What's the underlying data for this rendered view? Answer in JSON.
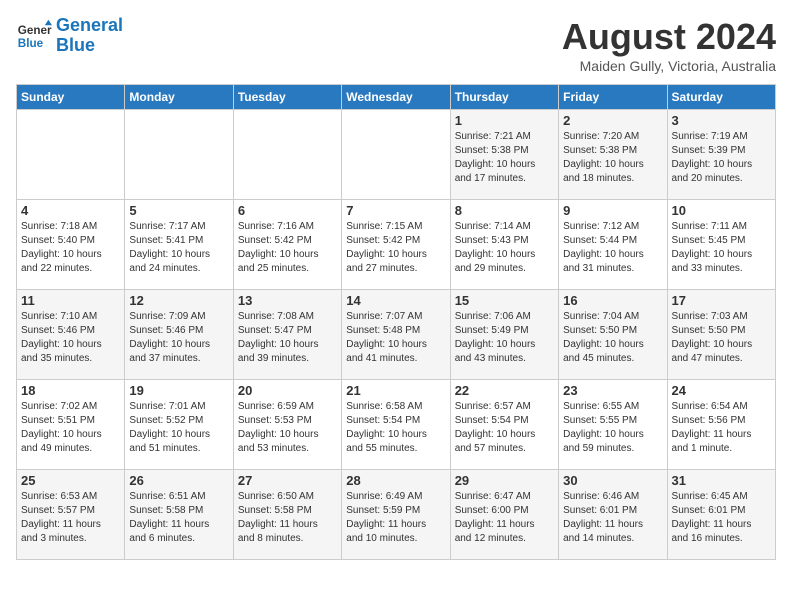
{
  "header": {
    "logo_text_general": "General",
    "logo_text_blue": "Blue",
    "month_title": "August 2024",
    "location": "Maiden Gully, Victoria, Australia"
  },
  "days_of_week": [
    "Sunday",
    "Monday",
    "Tuesday",
    "Wednesday",
    "Thursday",
    "Friday",
    "Saturday"
  ],
  "weeks": [
    [
      {
        "day": "",
        "info": ""
      },
      {
        "day": "",
        "info": ""
      },
      {
        "day": "",
        "info": ""
      },
      {
        "day": "",
        "info": ""
      },
      {
        "day": "1",
        "info": "Sunrise: 7:21 AM\nSunset: 5:38 PM\nDaylight: 10 hours\nand 17 minutes."
      },
      {
        "day": "2",
        "info": "Sunrise: 7:20 AM\nSunset: 5:38 PM\nDaylight: 10 hours\nand 18 minutes."
      },
      {
        "day": "3",
        "info": "Sunrise: 7:19 AM\nSunset: 5:39 PM\nDaylight: 10 hours\nand 20 minutes."
      }
    ],
    [
      {
        "day": "4",
        "info": "Sunrise: 7:18 AM\nSunset: 5:40 PM\nDaylight: 10 hours\nand 22 minutes."
      },
      {
        "day": "5",
        "info": "Sunrise: 7:17 AM\nSunset: 5:41 PM\nDaylight: 10 hours\nand 24 minutes."
      },
      {
        "day": "6",
        "info": "Sunrise: 7:16 AM\nSunset: 5:42 PM\nDaylight: 10 hours\nand 25 minutes."
      },
      {
        "day": "7",
        "info": "Sunrise: 7:15 AM\nSunset: 5:42 PM\nDaylight: 10 hours\nand 27 minutes."
      },
      {
        "day": "8",
        "info": "Sunrise: 7:14 AM\nSunset: 5:43 PM\nDaylight: 10 hours\nand 29 minutes."
      },
      {
        "day": "9",
        "info": "Sunrise: 7:12 AM\nSunset: 5:44 PM\nDaylight: 10 hours\nand 31 minutes."
      },
      {
        "day": "10",
        "info": "Sunrise: 7:11 AM\nSunset: 5:45 PM\nDaylight: 10 hours\nand 33 minutes."
      }
    ],
    [
      {
        "day": "11",
        "info": "Sunrise: 7:10 AM\nSunset: 5:46 PM\nDaylight: 10 hours\nand 35 minutes."
      },
      {
        "day": "12",
        "info": "Sunrise: 7:09 AM\nSunset: 5:46 PM\nDaylight: 10 hours\nand 37 minutes."
      },
      {
        "day": "13",
        "info": "Sunrise: 7:08 AM\nSunset: 5:47 PM\nDaylight: 10 hours\nand 39 minutes."
      },
      {
        "day": "14",
        "info": "Sunrise: 7:07 AM\nSunset: 5:48 PM\nDaylight: 10 hours\nand 41 minutes."
      },
      {
        "day": "15",
        "info": "Sunrise: 7:06 AM\nSunset: 5:49 PM\nDaylight: 10 hours\nand 43 minutes."
      },
      {
        "day": "16",
        "info": "Sunrise: 7:04 AM\nSunset: 5:50 PM\nDaylight: 10 hours\nand 45 minutes."
      },
      {
        "day": "17",
        "info": "Sunrise: 7:03 AM\nSunset: 5:50 PM\nDaylight: 10 hours\nand 47 minutes."
      }
    ],
    [
      {
        "day": "18",
        "info": "Sunrise: 7:02 AM\nSunset: 5:51 PM\nDaylight: 10 hours\nand 49 minutes."
      },
      {
        "day": "19",
        "info": "Sunrise: 7:01 AM\nSunset: 5:52 PM\nDaylight: 10 hours\nand 51 minutes."
      },
      {
        "day": "20",
        "info": "Sunrise: 6:59 AM\nSunset: 5:53 PM\nDaylight: 10 hours\nand 53 minutes."
      },
      {
        "day": "21",
        "info": "Sunrise: 6:58 AM\nSunset: 5:54 PM\nDaylight: 10 hours\nand 55 minutes."
      },
      {
        "day": "22",
        "info": "Sunrise: 6:57 AM\nSunset: 5:54 PM\nDaylight: 10 hours\nand 57 minutes."
      },
      {
        "day": "23",
        "info": "Sunrise: 6:55 AM\nSunset: 5:55 PM\nDaylight: 10 hours\nand 59 minutes."
      },
      {
        "day": "24",
        "info": "Sunrise: 6:54 AM\nSunset: 5:56 PM\nDaylight: 11 hours\nand 1 minute."
      }
    ],
    [
      {
        "day": "25",
        "info": "Sunrise: 6:53 AM\nSunset: 5:57 PM\nDaylight: 11 hours\nand 3 minutes."
      },
      {
        "day": "26",
        "info": "Sunrise: 6:51 AM\nSunset: 5:58 PM\nDaylight: 11 hours\nand 6 minutes."
      },
      {
        "day": "27",
        "info": "Sunrise: 6:50 AM\nSunset: 5:58 PM\nDaylight: 11 hours\nand 8 minutes."
      },
      {
        "day": "28",
        "info": "Sunrise: 6:49 AM\nSunset: 5:59 PM\nDaylight: 11 hours\nand 10 minutes."
      },
      {
        "day": "29",
        "info": "Sunrise: 6:47 AM\nSunset: 6:00 PM\nDaylight: 11 hours\nand 12 minutes."
      },
      {
        "day": "30",
        "info": "Sunrise: 6:46 AM\nSunset: 6:01 PM\nDaylight: 11 hours\nand 14 minutes."
      },
      {
        "day": "31",
        "info": "Sunrise: 6:45 AM\nSunset: 6:01 PM\nDaylight: 11 hours\nand 16 minutes."
      }
    ]
  ]
}
